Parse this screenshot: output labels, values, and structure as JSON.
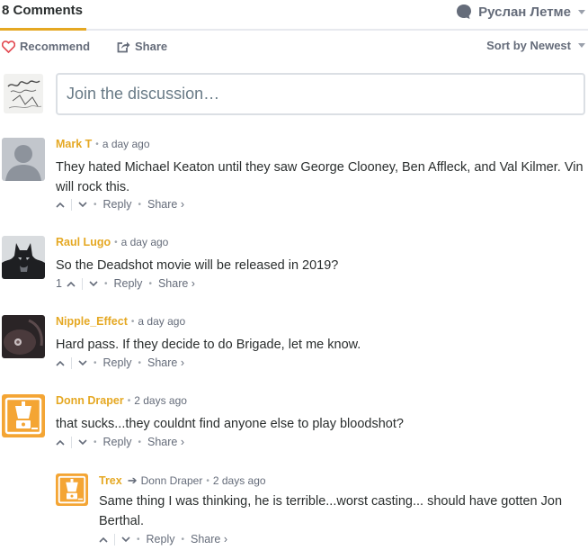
{
  "header": {
    "comment_count_label": "8 Comments",
    "user_name": "Руслан Летме"
  },
  "actions": {
    "recommend_label": "Recommend",
    "share_label": "Share",
    "sort_label": "Sort by Newest"
  },
  "composer": {
    "placeholder": "Join the discussion…"
  },
  "colors": {
    "accent": "#e5a823",
    "heart": "#e2464e",
    "muted": "#656c7a",
    "text": "#2a2e2e",
    "orange_avatar": "#f4a534"
  },
  "comments": [
    {
      "author": "Mark T",
      "time": "a day ago",
      "text": "They hated Michael Keaton until they saw George Clooney, Ben Affleck, and Val Kilmer. Vin will rock this.",
      "reply": "Reply",
      "share": "Share ›",
      "upvotes": ""
    },
    {
      "author": "Raul Lugo",
      "time": "a day ago",
      "text": "So the Deadshot movie will be released in 2019?",
      "reply": "Reply",
      "share": "Share ›",
      "upvotes": "1"
    },
    {
      "author": "Nipple_Effect",
      "time": "a day ago",
      "text": "Hard pass. If they decide to do Brigade, let me know.",
      "reply": "Reply",
      "share": "Share ›",
      "upvotes": ""
    },
    {
      "author": "Donn Draper",
      "time": "2 days ago",
      "text": "that sucks...they couldnt find anyone else to play bloodshot?",
      "reply": "Reply",
      "share": "Share ›",
      "upvotes": ""
    },
    {
      "author": "Trex",
      "in_reply_to": "Donn Draper",
      "time": "2 days ago",
      "text": "Same thing I was thinking, he is terrible...worst casting... should have gotten Jon Berthal.",
      "reply": "Reply",
      "share": "Share ›",
      "upvotes": ""
    }
  ]
}
